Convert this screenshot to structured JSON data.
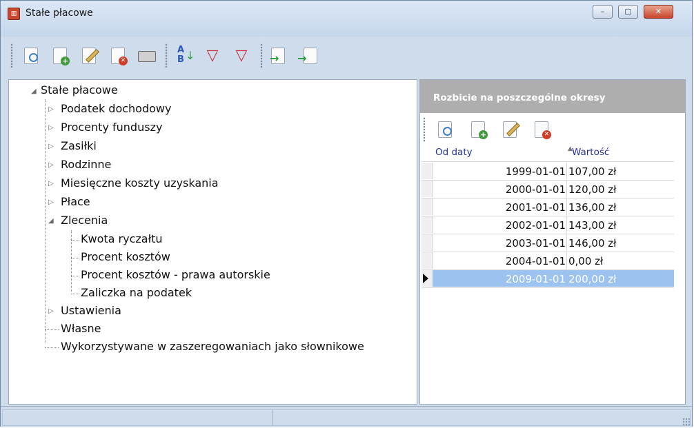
{
  "window": {
    "title": "Stałe płacowe",
    "controls": {
      "minimize": "–",
      "maximize": "▢",
      "close": "✕"
    }
  },
  "toolbar": {
    "buttons": [
      {
        "name": "preview-button",
        "icon": "document-search-icon"
      },
      {
        "name": "add-button",
        "icon": "document-add-icon"
      },
      {
        "name": "edit-button",
        "icon": "document-edit-icon"
      },
      {
        "name": "delete-button",
        "icon": "document-delete-icon"
      },
      {
        "name": "print-button",
        "icon": "printer-icon"
      },
      {
        "name": "sort-button",
        "icon": "sort-ab-icon",
        "glyph_top": "A",
        "glyph_bottom": "B"
      },
      {
        "name": "filter-edit-button",
        "icon": "filter-edit-icon"
      },
      {
        "name": "filter-button",
        "icon": "filter-icon"
      },
      {
        "name": "export-button",
        "icon": "document-export-icon"
      },
      {
        "name": "import-button",
        "icon": "document-import-icon"
      }
    ]
  },
  "tree": {
    "root": "Stałe płacowe",
    "items": [
      {
        "label": "Podatek dochodowy",
        "expanded": false
      },
      {
        "label": "Procenty funduszy",
        "expanded": false
      },
      {
        "label": "Zasiłki",
        "expanded": false
      },
      {
        "label": "Rodzinne",
        "expanded": false
      },
      {
        "label": "Miesięczne koszty uzyskania",
        "expanded": false
      },
      {
        "label": "Płace",
        "expanded": false
      },
      {
        "label": "Zlecenia",
        "expanded": true
      },
      {
        "label": "Kwota ryczałtu",
        "child": true
      },
      {
        "label": "Procent kosztów",
        "child": true
      },
      {
        "label": "Procent kosztów - prawa autorskie",
        "child": true
      },
      {
        "label": "Zaliczka na podatek",
        "child": true
      },
      {
        "label": "Ustawienia",
        "expanded": false
      },
      {
        "label": "Własne",
        "leaf": true
      },
      {
        "label": "Wykorzystywane w zaszeregowaniach jako słownikowe",
        "leaf": true
      }
    ]
  },
  "panel": {
    "title": "Rozbicie na poszczególne okresy",
    "columns": [
      "Od daty",
      "Wartość"
    ],
    "rows": [
      {
        "date": "1999-01-01",
        "value": "107,00 zł"
      },
      {
        "date": "2000-01-01",
        "value": "120,00 zł"
      },
      {
        "date": "2001-01-01",
        "value": "136,00 zł"
      },
      {
        "date": "2002-01-01",
        "value": "143,00 zł"
      },
      {
        "date": "2003-01-01",
        "value": "146,00 zł"
      },
      {
        "date": "2004-01-01",
        "value": "0,00 zł"
      },
      {
        "date": "2009-01-01",
        "value": "200,00 zł",
        "selected": true
      }
    ]
  },
  "colors": {
    "frame": "#cfdcec",
    "selection": "#9cc3f0",
    "panel_header": "#aeaeae",
    "column_header_text": "#23329b"
  }
}
